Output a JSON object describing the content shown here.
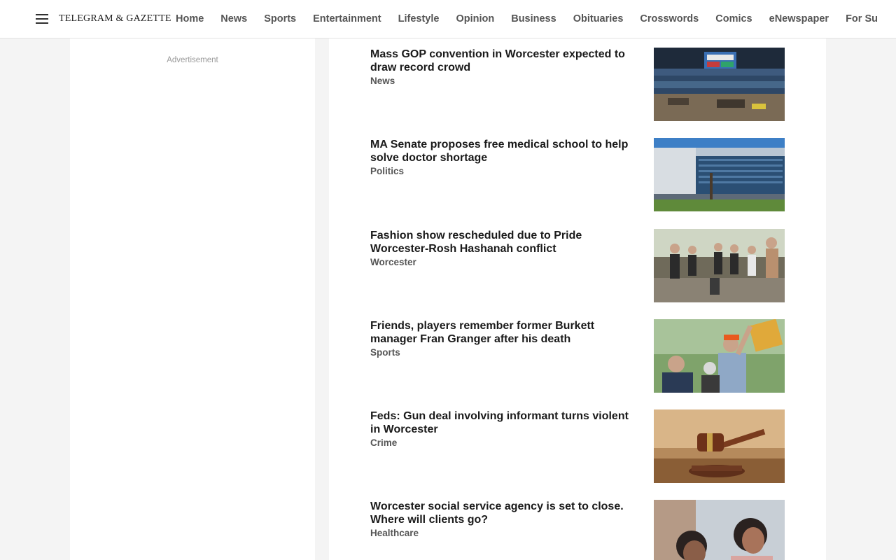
{
  "header": {
    "logo": "TELEGRAM & GAZETTE",
    "nav": [
      "Home",
      "News",
      "Sports",
      "Entertainment",
      "Lifestyle",
      "Opinion",
      "Business",
      "Obituaries",
      "Crosswords",
      "Comics",
      "eNewspaper",
      "For Su"
    ]
  },
  "sidebar": {
    "ad_label": "Advertisement"
  },
  "stories": [
    {
      "title": "Mass GOP convention in Worcester expected to draw record crowd",
      "category": "News",
      "image": "arena-photo"
    },
    {
      "title": "MA Senate proposes free medical school to help solve doctor shortage",
      "category": "Politics",
      "image": "medical-building-photo"
    },
    {
      "title": "Fashion show rescheduled due to Pride Worcester-Rosh Hashanah conflict",
      "category": "Worcester",
      "image": "group-photo"
    },
    {
      "title": "Friends, players remember former Burkett manager Fran Granger after his death",
      "category": "Sports",
      "image": "celebration-photo"
    },
    {
      "title": "Feds: Gun deal involving informant turns violent in Worcester",
      "category": "Crime",
      "image": "gavel-photo"
    },
    {
      "title": "Worcester social service agency is set to close. Where will clients go?",
      "category": "Healthcare",
      "image": "people-photo"
    }
  ]
}
